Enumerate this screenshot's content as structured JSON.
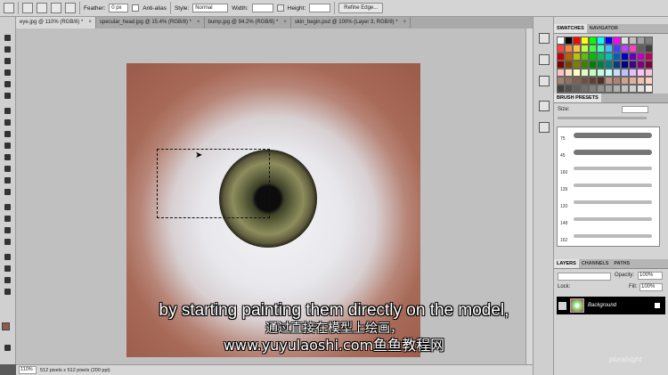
{
  "options_bar": {
    "feather_label": "Feather:",
    "feather_value": "0 px",
    "antialias_label": "Anti-alias",
    "style_label": "Style:",
    "style_value": "Normal",
    "width_label": "Width:",
    "height_label": "Height:",
    "refine_edge_label": "Refine Edge..."
  },
  "tabs": [
    {
      "label": "eye.jpg @ 110% (RGB/8) *",
      "active": true
    },
    {
      "label": "specular_head.jpg @ 15.4% (RGB/8) *"
    },
    {
      "label": "bump.jpg @ 94.2% (RGB/8) *"
    },
    {
      "label": "skin_begin.psd @ 100% (Layer 3, RGB/8) *"
    }
  ],
  "tab_close": "×",
  "status": {
    "zoom": "110%",
    "info": "512 pixels x 512 pixels (200 ppi)"
  },
  "swatches_panel": {
    "tab_swatches": "SWATCHES",
    "tab_navigator": "NAVIGATOR",
    "colors": [
      "#ffffff",
      "#000000",
      "#ff0000",
      "#ffff00",
      "#00ff00",
      "#00ffff",
      "#0000ff",
      "#ff00ff",
      "#e0e0e0",
      "#c0c0c0",
      "#a0a0a0",
      "#808080",
      "#ff4040",
      "#ff8040",
      "#ffc040",
      "#c0ff40",
      "#40ff40",
      "#40ffc0",
      "#40c0ff",
      "#4040ff",
      "#c040ff",
      "#ff40c0",
      "#606060",
      "#404040",
      "#c00000",
      "#c06000",
      "#c0c000",
      "#60c000",
      "#00c000",
      "#00c060",
      "#00c0c0",
      "#0060c0",
      "#0000c0",
      "#6000c0",
      "#c000c0",
      "#c00060",
      "#800000",
      "#804000",
      "#808000",
      "#408000",
      "#008000",
      "#008040",
      "#008080",
      "#004080",
      "#000080",
      "#400080",
      "#800080",
      "#800040",
      "#ffc0c0",
      "#ffe0c0",
      "#ffffc0",
      "#e0ffc0",
      "#c0ffc0",
      "#c0ffe0",
      "#c0ffff",
      "#c0e0ff",
      "#c0c0ff",
      "#e0c0ff",
      "#ffc0ff",
      "#ffc0e0",
      "#a08070",
      "#907060",
      "#806050",
      "#705040",
      "#604030",
      "#503020",
      "#c09080",
      "#b08070",
      "#d0a090",
      "#e0b0a0",
      "#f0c0b0",
      "#ffd0c0",
      "#404040",
      "#505050",
      "#606060",
      "#707070",
      "#808080",
      "#909090",
      "#a0a0a0",
      "#b0b0b0",
      "#c0c0c0",
      "#d0d0d0",
      "#e0e0e0",
      "#f0f0f0",
      "#8b4513",
      "#a0522d",
      "#cd853f",
      "#deb887",
      "#f5deb3",
      "#d2b48c",
      "#bc8f8f",
      "#f4a460",
      "#daa520",
      "#b8860b",
      "#d2691e",
      "#ff7f50"
    ]
  },
  "brush_presets": {
    "tab": "BRUSH PRESETS",
    "size_label": "Size:",
    "items": [
      "75",
      "45",
      "160",
      "139",
      "120",
      "148",
      "162"
    ]
  },
  "layers_panel": {
    "tab_layers": "LAYERS",
    "tab_channels": "CHANNELS",
    "tab_paths": "PATHS",
    "opacity_label": "Opacity:",
    "opacity_value": "100%",
    "lock_label": "Lock:",
    "fill_label": "Fill:",
    "fill_value": "100%",
    "layer_name": "Background"
  },
  "subtitles": {
    "english": "by starting painting them directly on the model,",
    "chinese": "通过直接在模型上绘画，",
    "site": "www.yuyulaoshi.com鱼鱼教程网"
  },
  "watermark": "pluralsight"
}
